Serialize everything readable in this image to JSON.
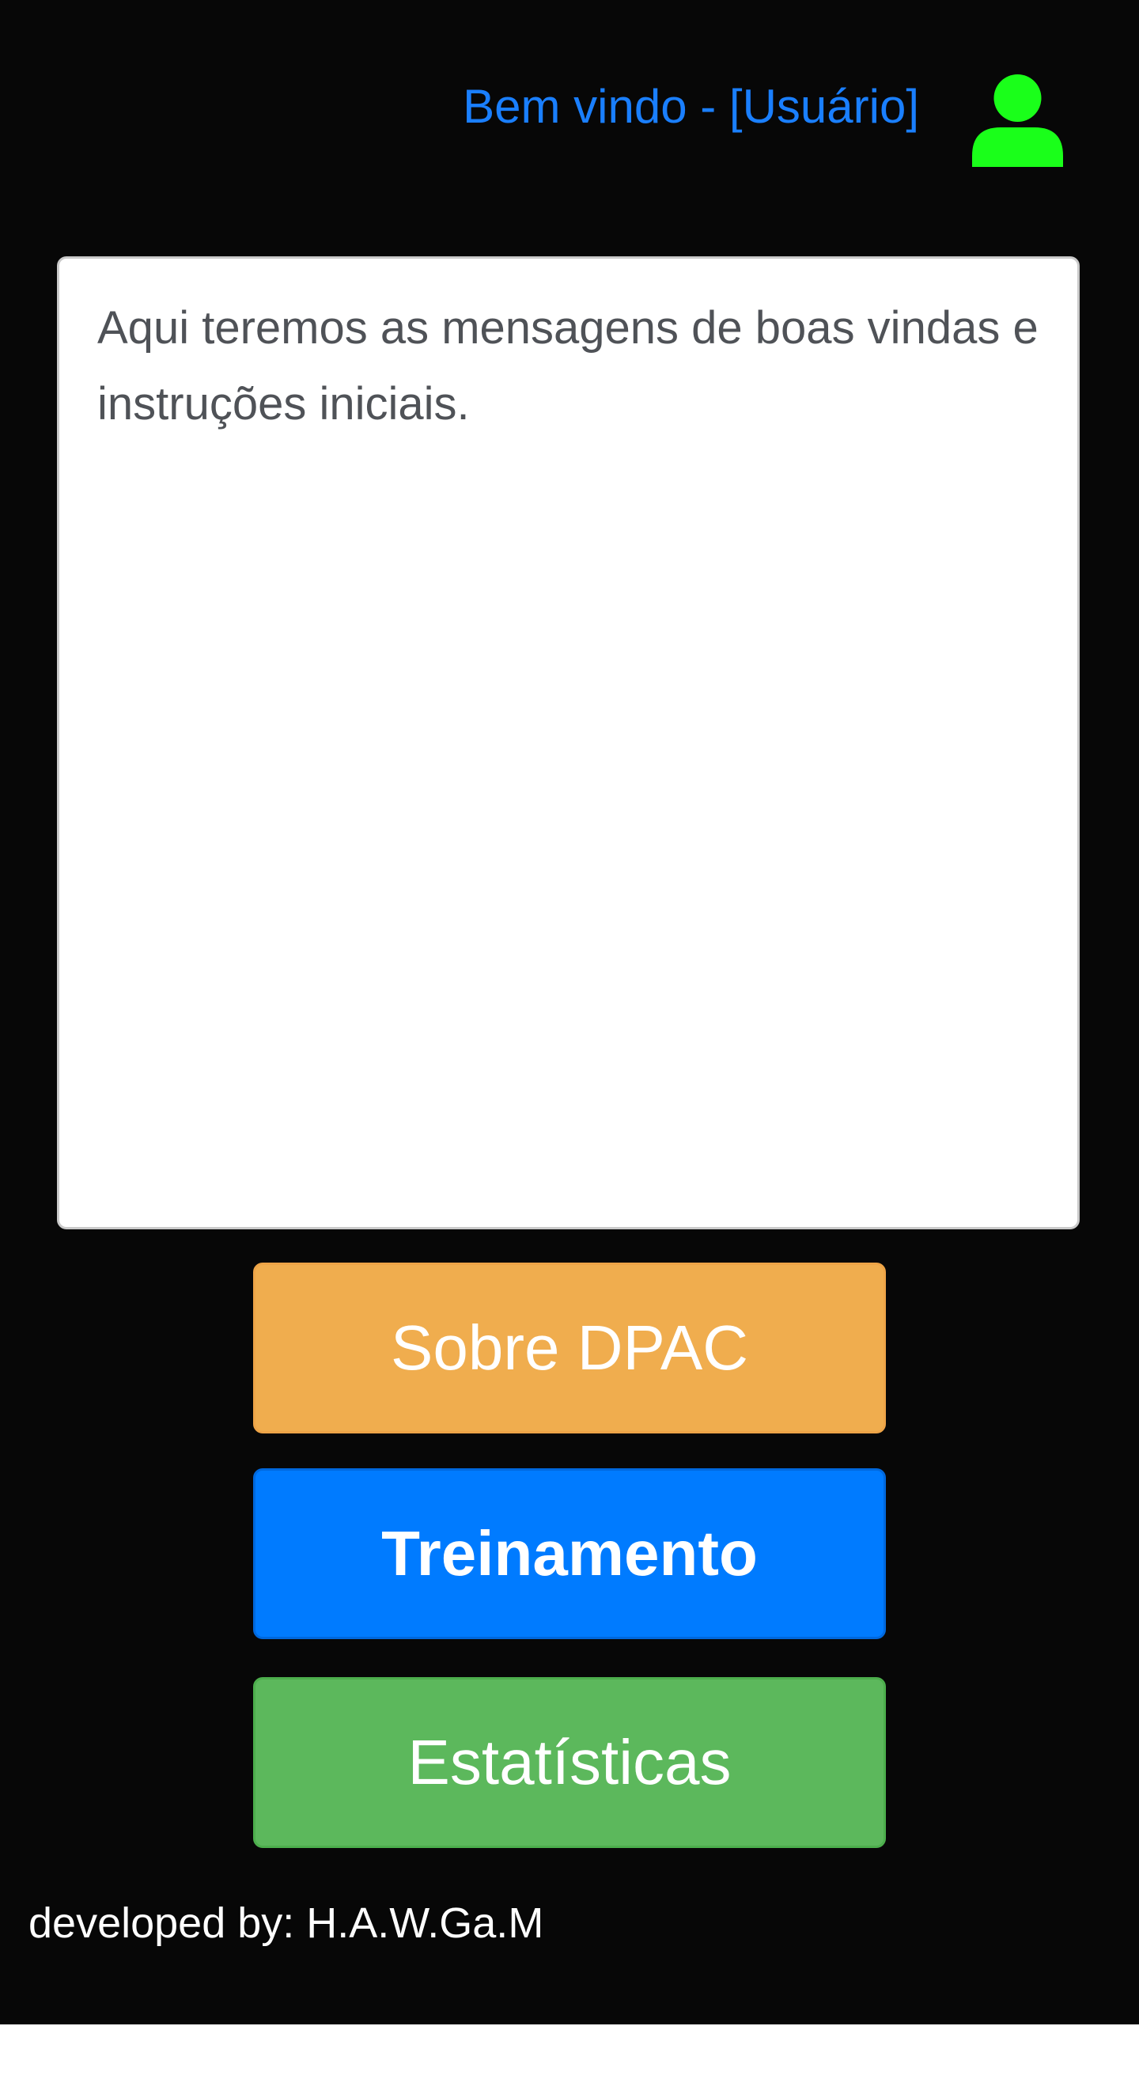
{
  "header": {
    "welcome_text": "Bem vindo - [Usuário]",
    "user_icon": "user-icon",
    "user_icon_color": "#1aff1a",
    "welcome_color": "#1a7fff"
  },
  "main": {
    "message_text": "Aqui teremos as mensagens de boas vindas e instruções iniciais."
  },
  "buttons": {
    "sobre_label": "Sobre DPAC",
    "treinamento_label": "Treinamento",
    "estatisticas_label": "Estatísticas",
    "sobre_color": "#f0ad4e",
    "treinamento_color": "#007bff",
    "estatisticas_color": "#5cb85c"
  },
  "footer": {
    "credit_text": "developed by: H.A.W.Ga.M"
  }
}
